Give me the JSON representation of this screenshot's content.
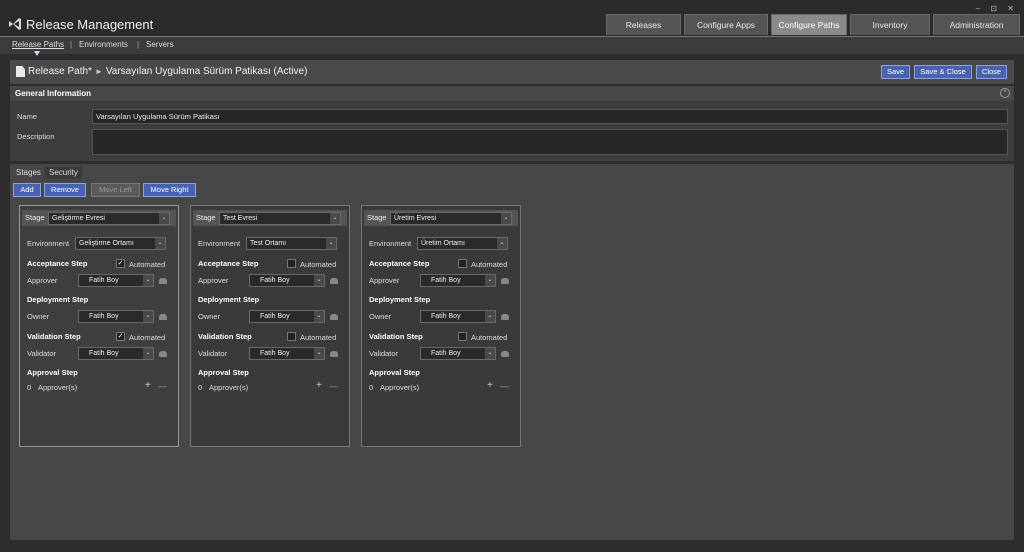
{
  "app": {
    "title": "Release Management",
    "win_controls": "‒ ⊡ ✕"
  },
  "tabs": [
    {
      "label": "Releases"
    },
    {
      "label": "Configure Apps"
    },
    {
      "label": "Configure Paths"
    },
    {
      "label": "Inventory"
    },
    {
      "label": "Administration"
    }
  ],
  "subnav": {
    "items": [
      "Release Paths",
      "Environments",
      "Servers"
    ],
    "separator": "|"
  },
  "header": {
    "breadcrumb_root": "Release Path*",
    "arrow": "►",
    "title": "Varsayılan Uygulama Sürüm Patikası (Active)",
    "save": "Save",
    "save_close": "Save & Close",
    "close": "Close"
  },
  "general": {
    "title": "General Information",
    "collapse_icon": "^",
    "name_label": "Name",
    "name_value": "Varsayılan Uygulama Sürüm Patikası",
    "description_label": "Description",
    "description_value": ""
  },
  "subtabs": {
    "stages": "Stages",
    "security": "Security"
  },
  "actions": {
    "add": "Add",
    "remove": "Remove",
    "move_left": "Move Left",
    "move_right": "Move Right"
  },
  "labels": {
    "stage": "Stage",
    "environment": "Environment",
    "acceptance_step": "Acceptance Step",
    "automated": "Automated",
    "approver": "Approver",
    "deployment_step": "Deployment Step",
    "owner": "Owner",
    "validation_step": "Validation Step",
    "validator": "Validator",
    "approval_step": "Approval Step",
    "approvers_suffix": "Approver(s)",
    "chevron": "⌄",
    "check": "✓",
    "plus": "+",
    "minus": "—"
  },
  "stages": [
    {
      "stage": "Geliştirme Evresi",
      "environment": "Geliştirme Ortamı",
      "acceptance_automated": true,
      "approver": "Fatih Boy",
      "owner": "Fatih Boy",
      "validation_automated": true,
      "validator": "Fatih Boy",
      "approvers_count": "0"
    },
    {
      "stage": "Test Evresi",
      "environment": "Test Ortamı",
      "acceptance_automated": false,
      "approver": "Fatih Boy",
      "owner": "Fatih Boy",
      "validation_automated": false,
      "validator": "Fatih Boy",
      "approvers_count": "0"
    },
    {
      "stage": "Üretim Evresi",
      "environment": "Üretim Ortamı",
      "acceptance_automated": false,
      "approver": "Fatih Boy",
      "owner": "Fatih Boy",
      "validation_automated": false,
      "validator": "Fatih Boy",
      "approvers_count": "0"
    }
  ],
  "colors": {
    "accent_button": "#4a63b0",
    "background": "#2d2d2d",
    "active_tab": "#8a8a8a"
  }
}
